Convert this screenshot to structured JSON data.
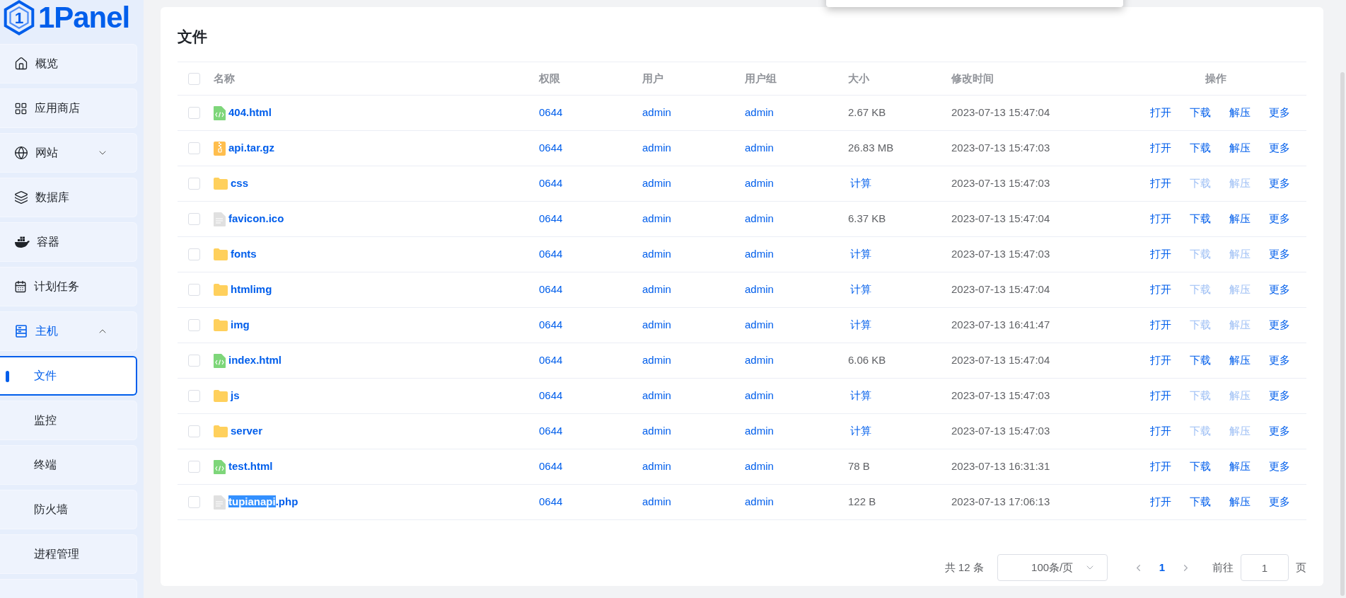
{
  "logo": {
    "mark": "1",
    "text": "1Panel"
  },
  "sidebar": {
    "items": [
      {
        "label": "概览",
        "selected": false
      },
      {
        "label": "应用商店",
        "selected": false
      },
      {
        "label": "网站",
        "selected": false,
        "expanded": false
      },
      {
        "label": "数据库",
        "selected": false
      },
      {
        "label": "容器",
        "selected": false
      },
      {
        "label": "计划任务",
        "selected": false
      },
      {
        "label": "主机",
        "selected": true,
        "expanded": true,
        "children": [
          {
            "label": "文件",
            "selected": true
          },
          {
            "label": "监控",
            "selected": false
          },
          {
            "label": "终端",
            "selected": false
          },
          {
            "label": "防火墙",
            "selected": false
          },
          {
            "label": "进程管理",
            "selected": false
          }
        ]
      }
    ]
  },
  "page": {
    "title": "文件"
  },
  "table": {
    "select_all_checked": false,
    "columns": [
      "名称",
      "权限",
      "用户",
      "用户组",
      "大小",
      "修改时间",
      "操作"
    ],
    "rows": [
      {
        "checked": false,
        "kind": "html",
        "name_parts": [
          {
            "text": "404.html",
            "highlighted": false
          }
        ],
        "permission": "0644",
        "user": "admin",
        "group": "admin",
        "size": {
          "kind": "text",
          "text": "2.67 KB"
        },
        "modified": "2023-07-13 15:47:04",
        "actions": [
          {
            "label": "打开",
            "disabled": false
          },
          {
            "label": "下载",
            "disabled": false
          },
          {
            "label": "解压",
            "disabled": false
          },
          {
            "label": "更多",
            "disabled": false
          }
        ]
      },
      {
        "checked": false,
        "kind": "archive",
        "name_parts": [
          {
            "text": "api.tar.gz",
            "highlighted": false
          }
        ],
        "permission": "0644",
        "user": "admin",
        "group": "admin",
        "size": {
          "kind": "text",
          "text": "26.83 MB"
        },
        "modified": "2023-07-13 15:47:03",
        "actions": [
          {
            "label": "打开",
            "disabled": false
          },
          {
            "label": "下载",
            "disabled": false
          },
          {
            "label": "解压",
            "disabled": false
          },
          {
            "label": "更多",
            "disabled": false
          }
        ]
      },
      {
        "checked": false,
        "kind": "folder",
        "name_parts": [
          {
            "text": "css",
            "highlighted": false
          }
        ],
        "permission": "0644",
        "user": "admin",
        "group": "admin",
        "size": {
          "kind": "link",
          "text": "计算"
        },
        "modified": "2023-07-13 15:47:03",
        "actions": [
          {
            "label": "打开",
            "disabled": false
          },
          {
            "label": "下载",
            "disabled": true
          },
          {
            "label": "解压",
            "disabled": true
          },
          {
            "label": "更多",
            "disabled": false
          }
        ]
      },
      {
        "checked": false,
        "kind": "file",
        "name_parts": [
          {
            "text": "favicon.ico",
            "highlighted": false
          }
        ],
        "permission": "0644",
        "user": "admin",
        "group": "admin",
        "size": {
          "kind": "text",
          "text": "6.37 KB"
        },
        "modified": "2023-07-13 15:47:04",
        "actions": [
          {
            "label": "打开",
            "disabled": false
          },
          {
            "label": "下载",
            "disabled": false
          },
          {
            "label": "解压",
            "disabled": false
          },
          {
            "label": "更多",
            "disabled": false
          }
        ]
      },
      {
        "checked": false,
        "kind": "folder",
        "name_parts": [
          {
            "text": "fonts",
            "highlighted": false
          }
        ],
        "permission": "0644",
        "user": "admin",
        "group": "admin",
        "size": {
          "kind": "link",
          "text": "计算"
        },
        "modified": "2023-07-13 15:47:03",
        "actions": [
          {
            "label": "打开",
            "disabled": false
          },
          {
            "label": "下载",
            "disabled": true
          },
          {
            "label": "解压",
            "disabled": true
          },
          {
            "label": "更多",
            "disabled": false
          }
        ]
      },
      {
        "checked": false,
        "kind": "folder",
        "name_parts": [
          {
            "text": "htmlimg",
            "highlighted": false
          }
        ],
        "permission": "0644",
        "user": "admin",
        "group": "admin",
        "size": {
          "kind": "link",
          "text": "计算"
        },
        "modified": "2023-07-13 15:47:04",
        "actions": [
          {
            "label": "打开",
            "disabled": false
          },
          {
            "label": "下载",
            "disabled": true
          },
          {
            "label": "解压",
            "disabled": true
          },
          {
            "label": "更多",
            "disabled": false
          }
        ]
      },
      {
        "checked": false,
        "kind": "folder",
        "name_parts": [
          {
            "text": "img",
            "highlighted": false
          }
        ],
        "permission": "0644",
        "user": "admin",
        "group": "admin",
        "size": {
          "kind": "link",
          "text": "计算"
        },
        "modified": "2023-07-13 16:41:47",
        "actions": [
          {
            "label": "打开",
            "disabled": false
          },
          {
            "label": "下载",
            "disabled": true
          },
          {
            "label": "解压",
            "disabled": true
          },
          {
            "label": "更多",
            "disabled": false
          }
        ]
      },
      {
        "checked": false,
        "kind": "html",
        "name_parts": [
          {
            "text": "index.html",
            "highlighted": false
          }
        ],
        "permission": "0644",
        "user": "admin",
        "group": "admin",
        "size": {
          "kind": "text",
          "text": "6.06 KB"
        },
        "modified": "2023-07-13 15:47:04",
        "actions": [
          {
            "label": "打开",
            "disabled": false
          },
          {
            "label": "下载",
            "disabled": false
          },
          {
            "label": "解压",
            "disabled": false
          },
          {
            "label": "更多",
            "disabled": false
          }
        ]
      },
      {
        "checked": false,
        "kind": "folder",
        "name_parts": [
          {
            "text": "js",
            "highlighted": false
          }
        ],
        "permission": "0644",
        "user": "admin",
        "group": "admin",
        "size": {
          "kind": "link",
          "text": "计算"
        },
        "modified": "2023-07-13 15:47:03",
        "actions": [
          {
            "label": "打开",
            "disabled": false
          },
          {
            "label": "下载",
            "disabled": true
          },
          {
            "label": "解压",
            "disabled": true
          },
          {
            "label": "更多",
            "disabled": false
          }
        ]
      },
      {
        "checked": false,
        "kind": "folder",
        "name_parts": [
          {
            "text": "server",
            "highlighted": false
          }
        ],
        "permission": "0644",
        "user": "admin",
        "group": "admin",
        "size": {
          "kind": "link",
          "text": "计算"
        },
        "modified": "2023-07-13 15:47:03",
        "actions": [
          {
            "label": "打开",
            "disabled": false
          },
          {
            "label": "下载",
            "disabled": true
          },
          {
            "label": "解压",
            "disabled": true
          },
          {
            "label": "更多",
            "disabled": false
          }
        ]
      },
      {
        "checked": false,
        "kind": "html",
        "name_parts": [
          {
            "text": "test.html",
            "highlighted": false
          }
        ],
        "permission": "0644",
        "user": "admin",
        "group": "admin",
        "size": {
          "kind": "text",
          "text": "78 B"
        },
        "modified": "2023-07-13 16:31:31",
        "actions": [
          {
            "label": "打开",
            "disabled": false
          },
          {
            "label": "下载",
            "disabled": false
          },
          {
            "label": "解压",
            "disabled": false
          },
          {
            "label": "更多",
            "disabled": false
          }
        ]
      },
      {
        "checked": false,
        "kind": "file",
        "name_parts": [
          {
            "text": "tupianapi",
            "highlighted": true
          },
          {
            "text": ".php",
            "highlighted": false
          }
        ],
        "permission": "0644",
        "user": "admin",
        "group": "admin",
        "size": {
          "kind": "text",
          "text": "122 B"
        },
        "modified": "2023-07-13 17:06:13",
        "actions": [
          {
            "label": "打开",
            "disabled": false
          },
          {
            "label": "下载",
            "disabled": false
          },
          {
            "label": "解压",
            "disabled": false
          },
          {
            "label": "更多",
            "disabled": false
          }
        ]
      }
    ]
  },
  "pagination": {
    "total": "共 12 条",
    "page_size": "100条/页",
    "pages": [
      {
        "label": "1",
        "selected": true
      }
    ],
    "goto_label": "前往",
    "goto_value": "1",
    "goto_suffix": "页"
  }
}
